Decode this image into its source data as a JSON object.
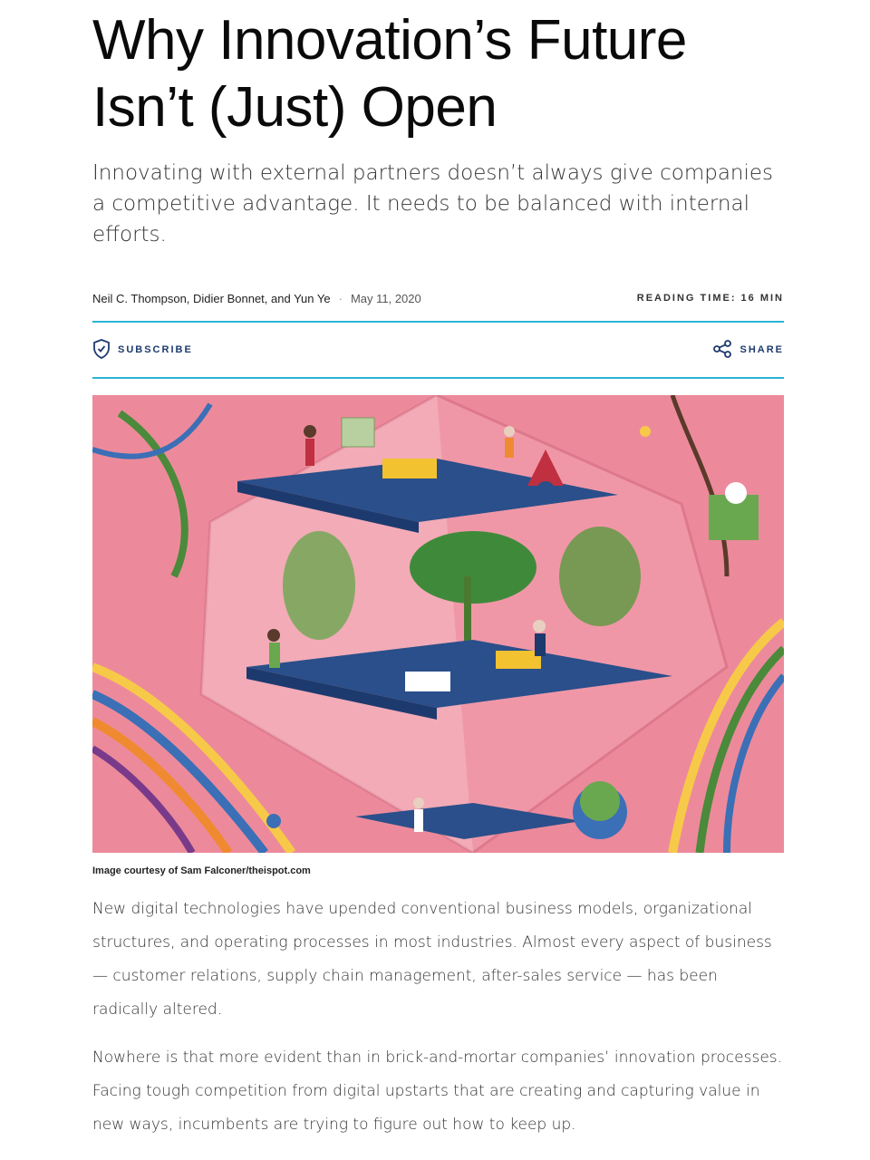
{
  "article": {
    "title": "Why Innovation’s Future Isn’t (Just) Open",
    "dek": "Innovating with external partners doesn’t always give companies a competitive advantage. It needs to be balanced with internal efforts.",
    "authors": "Neil C. Thompson, Didier Bonnet, and Yun Ye",
    "separator": "·",
    "date": "May 11, 2020",
    "reading_time": "READING TIME: 16 MIN"
  },
  "actions": {
    "subscribe_label": "SUBSCRIBE",
    "share_label": "SHARE"
  },
  "image": {
    "caption": "Image courtesy of Sam Falconer/theispot.com",
    "icon": "illustration-image"
  },
  "body": {
    "paragraphs": [
      "New digital technologies have upended conventional business models, organizational structures, and operating processes in most industries. Almost every aspect of business — customer relations, supply chain management, after-sales service — has been radically altered.",
      "Nowhere is that more evident than in brick-and-mortar companies’ innovation processes. Facing tough competition from digital upstarts that are creating and capturing value in new ways, incumbents are trying to figure out how to keep up."
    ]
  },
  "colors": {
    "accent": "#2bb3d6",
    "action_text": "#1d3a6e",
    "hero_background": "#ec8a9b"
  }
}
